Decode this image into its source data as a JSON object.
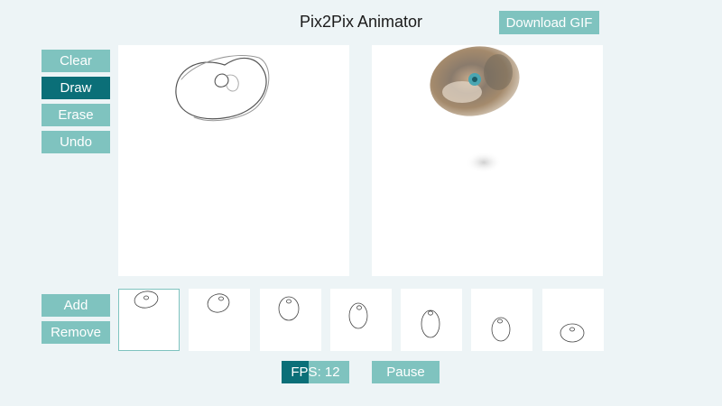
{
  "app": {
    "title": "Pix2Pix Animator"
  },
  "toolbar": {
    "download_label": "Download GIF",
    "tools": [
      {
        "key": "clear",
        "label": "Clear",
        "active": false
      },
      {
        "key": "draw",
        "label": "Draw",
        "active": true
      },
      {
        "key": "erase",
        "label": "Erase",
        "active": false
      },
      {
        "key": "undo",
        "label": "Undo",
        "active": false
      }
    ]
  },
  "frames_panel": {
    "add_label": "Add",
    "remove_label": "Remove",
    "selected_index": 0,
    "frame_count": 7
  },
  "playback": {
    "fps_label": "FPS: 12",
    "fps_value": 12,
    "fps_fill_fraction": 0.4,
    "pause_label": "Pause"
  },
  "colors": {
    "accent": "#7fc3bf",
    "accent_active": "#0b6f78",
    "background": "#edf4f6"
  }
}
